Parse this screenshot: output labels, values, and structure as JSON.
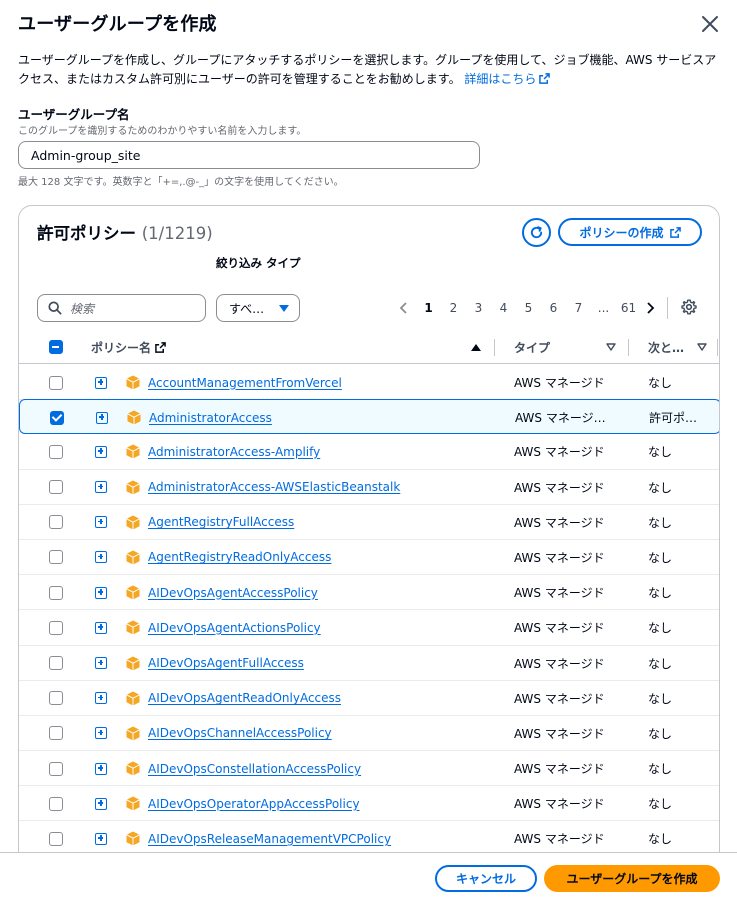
{
  "modal": {
    "title": "ユーザーグループを作成",
    "description": "ユーザーグループを作成し、グループにアタッチするポリシーを選択します。グループを使用して、ジョブ機能、AWS サービスアクセス、またはカスタム許可別にユーザーの許可を管理することをお勧めします。",
    "learn_more": "詳細はこちら"
  },
  "group_name": {
    "label": "ユーザーグループ名",
    "hint": "このグループを識別するためのわかりやすい名前を入力します。",
    "value": "Admin-group_site",
    "constraint": "最大 128 文字です。英数字と「+=,.@-_」の文字を使用してください。"
  },
  "policies": {
    "title": "許可ポリシー",
    "count": "(1/1219)",
    "create_policy_label": "ポリシーの作成",
    "filter_label": "絞り込み タイプ",
    "search_placeholder": "検索",
    "type_filter_value": "すべ…",
    "pagination": {
      "pages": [
        "1",
        "2",
        "3",
        "4",
        "5",
        "6",
        "7",
        "...",
        "61"
      ],
      "current": "1"
    },
    "columns": {
      "name": "ポリシー名",
      "type": "タイプ",
      "next": "次と…"
    },
    "rows": [
      {
        "name": "AccountManagementFromVercel",
        "type": "AWS マネージド",
        "next": "なし",
        "checked": false
      },
      {
        "name": "AdministratorAccess",
        "type": "AWS マネージ…",
        "next": "許可ポ…",
        "checked": true
      },
      {
        "name": "AdministratorAccess-Amplify",
        "type": "AWS マネージド",
        "next": "なし",
        "checked": false
      },
      {
        "name": "AdministratorAccess-AWSElasticBeanstalk",
        "type": "AWS マネージド",
        "next": "なし",
        "checked": false
      },
      {
        "name": "AgentRegistryFullAccess",
        "type": "AWS マネージド",
        "next": "なし",
        "checked": false
      },
      {
        "name": "AgentRegistryReadOnlyAccess",
        "type": "AWS マネージド",
        "next": "なし",
        "checked": false
      },
      {
        "name": "AIDevOpsAgentAccessPolicy",
        "type": "AWS マネージド",
        "next": "なし",
        "checked": false
      },
      {
        "name": "AIDevOpsAgentActionsPolicy",
        "type": "AWS マネージド",
        "next": "なし",
        "checked": false
      },
      {
        "name": "AIDevOpsAgentFullAccess",
        "type": "AWS マネージド",
        "next": "なし",
        "checked": false
      },
      {
        "name": "AIDevOpsAgentReadOnlyAccess",
        "type": "AWS マネージド",
        "next": "なし",
        "checked": false
      },
      {
        "name": "AIDevOpsChannelAccessPolicy",
        "type": "AWS マネージド",
        "next": "なし",
        "checked": false
      },
      {
        "name": "AIDevOpsConstellationAccessPolicy",
        "type": "AWS マネージド",
        "next": "なし",
        "checked": false
      },
      {
        "name": "AIDevOpsOperatorAppAccessPolicy",
        "type": "AWS マネージド",
        "next": "なし",
        "checked": false
      },
      {
        "name": "AIDevOpsReleaseManagementVPCPolicy",
        "type": "AWS マネージド",
        "next": "なし",
        "checked": false
      }
    ]
  },
  "footer": {
    "cancel_label": "キャンセル",
    "create_label": "ユーザーグループを作成"
  },
  "colors": {
    "accent": "#006ce0",
    "primary_button": "#ff9900",
    "managed_policy_icon": "#f5a623"
  },
  "icons": [
    "close-icon",
    "external-link-icon",
    "refresh-icon",
    "search-icon",
    "settings-icon",
    "chevron-left-icon",
    "chevron-right-icon",
    "expand-icon",
    "aws-managed-policy-icon"
  ]
}
